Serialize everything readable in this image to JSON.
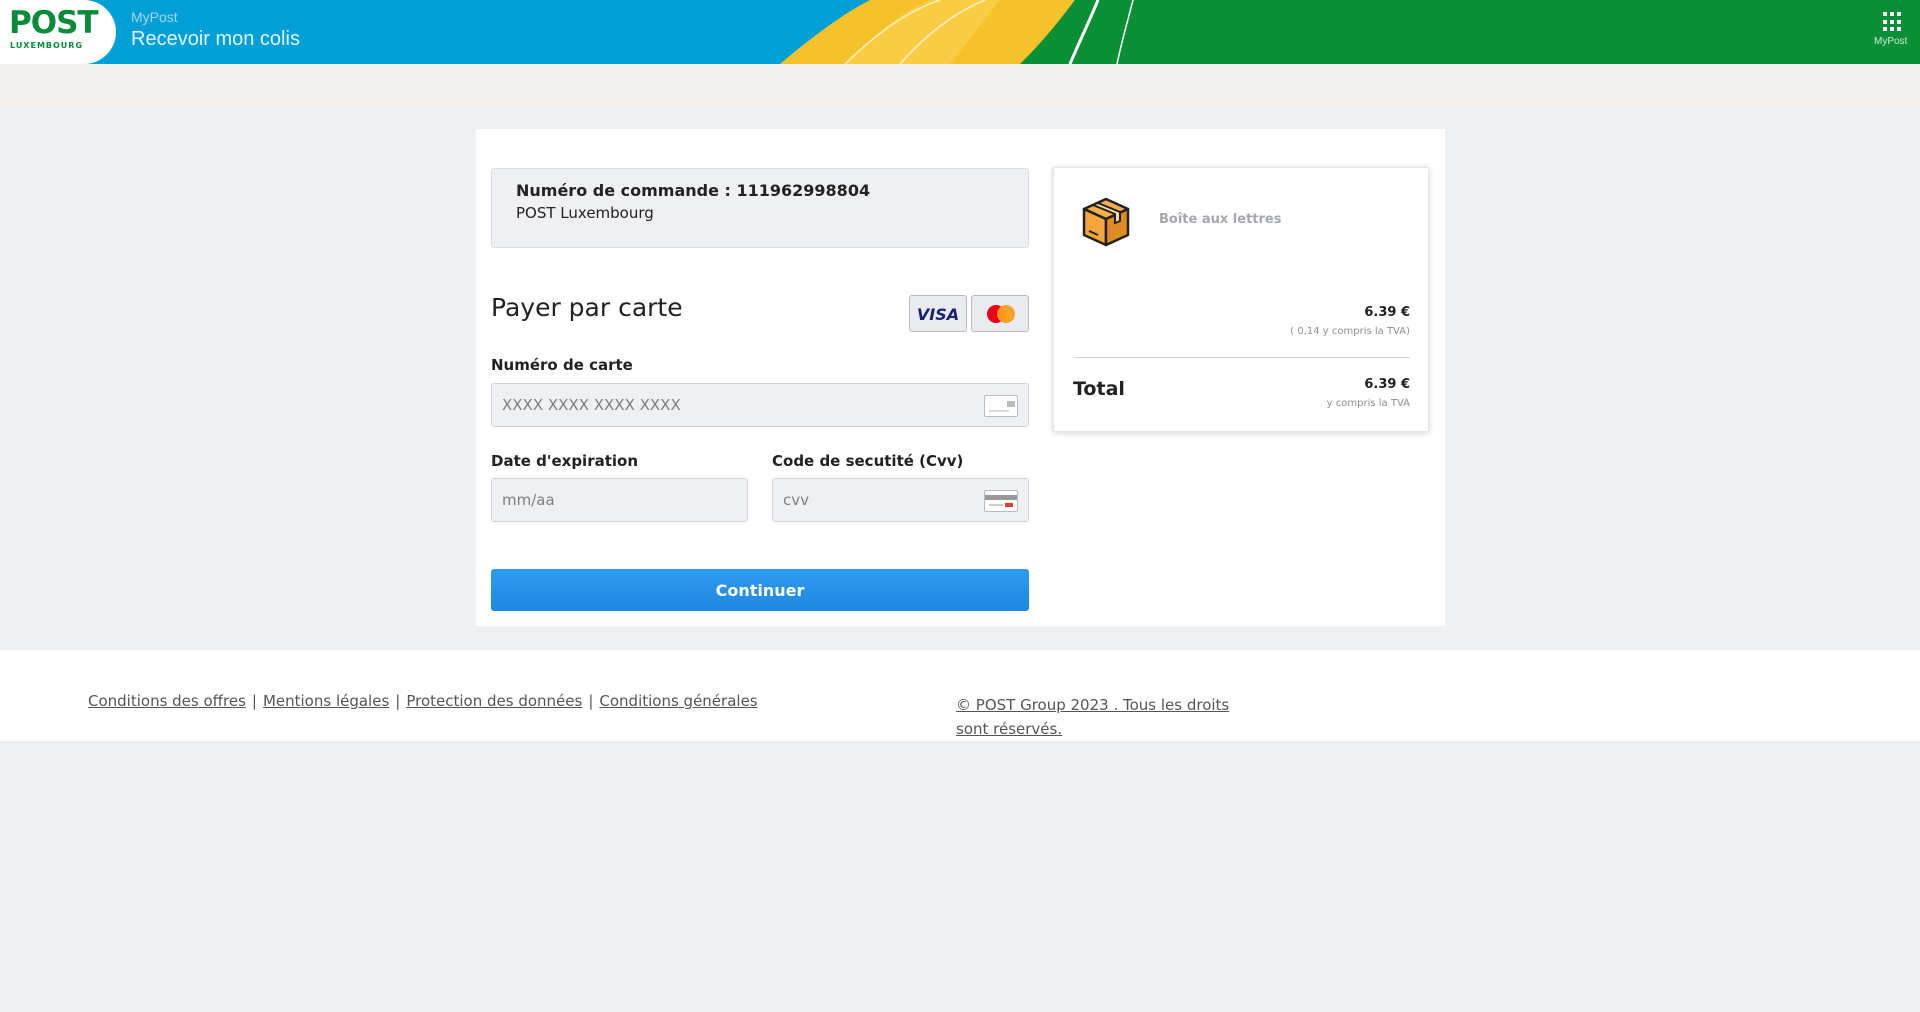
{
  "header": {
    "logo_text": "POST",
    "logo_subtext": "LUXEMBOURG",
    "app_name": "MyPost",
    "page_title": "Recevoir mon colis",
    "apps_label": "MyPost",
    "colors": {
      "blue": "#00a0d6",
      "yellow": "#f6c22b",
      "green": "#0a8f37"
    }
  },
  "order": {
    "number_line": "Numéro de commande : 111962998804",
    "merchant": "POST Luxembourg"
  },
  "payment": {
    "title": "Payer par carte",
    "visa_label": "VISA",
    "card_number": {
      "label": "Numéro de carte",
      "placeholder": "XXXX XXXX XXXX XXXX",
      "value": ""
    },
    "expiry": {
      "label": "Date d'expiration",
      "placeholder": "mm/aa",
      "value": ""
    },
    "cvv": {
      "label": "Code de secutité (Cvv)",
      "placeholder": "cvv",
      "value": ""
    },
    "continue_label": "Continuer",
    "button_color": "#2690e8"
  },
  "summary": {
    "item_icon": "package-box-icon",
    "item_name": "Boîte aux lettres",
    "item_price": "6.39 €",
    "item_vat": "( 0,14 y compris la TVA)",
    "total_label": "Total",
    "total_price": "6.39 €",
    "total_vat": "y compris la TVA"
  },
  "footer": {
    "links": [
      "Conditions des offres",
      "Mentions légales",
      "Protection des données",
      "Conditions générales"
    ],
    "separator": "|",
    "copyright": "© POST Group 2023 . Tous les droits sont réservés."
  }
}
